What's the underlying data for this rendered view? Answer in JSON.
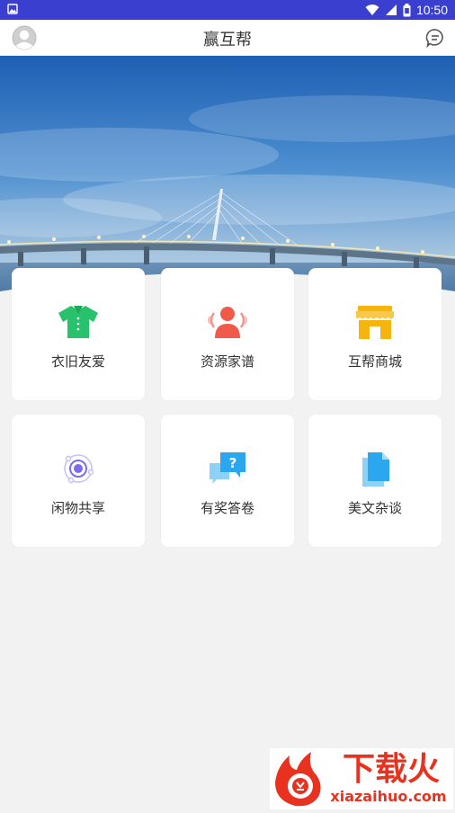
{
  "status_bar": {
    "time": "10:50",
    "icons": [
      "photo-notification-icon",
      "wifi-icon",
      "signal-icon",
      "battery-icon"
    ]
  },
  "header": {
    "title": "赢互帮",
    "left_icon": "avatar-icon",
    "right_icon": "message-icon"
  },
  "banner": {
    "image_semantic": "sea bridge under blue sky"
  },
  "grid": {
    "items": [
      {
        "label": "衣旧友爱",
        "icon": "tshirt-icon",
        "color": "#27c26b"
      },
      {
        "label": "资源家谱",
        "icon": "family-icon",
        "color": "#f05a4a"
      },
      {
        "label": "互帮商城",
        "icon": "store-icon",
        "color": "#f5b50f"
      },
      {
        "label": "闲物共享",
        "icon": "orbit-share-icon",
        "color": "#7b6bf0"
      },
      {
        "label": "有奖答卷",
        "icon": "question-chat-icon",
        "color": "#2aa7ef"
      },
      {
        "label": "美文杂谈",
        "icon": "document-icon",
        "color": "#2aa7ef"
      }
    ]
  },
  "watermark": {
    "brand": "下载火",
    "site": "xiazaihuo.com"
  },
  "colors": {
    "status_bar": "#3b3fd0",
    "background": "#f2f2f2",
    "card": "#ffffff",
    "watermark_red": "#e8321f"
  }
}
